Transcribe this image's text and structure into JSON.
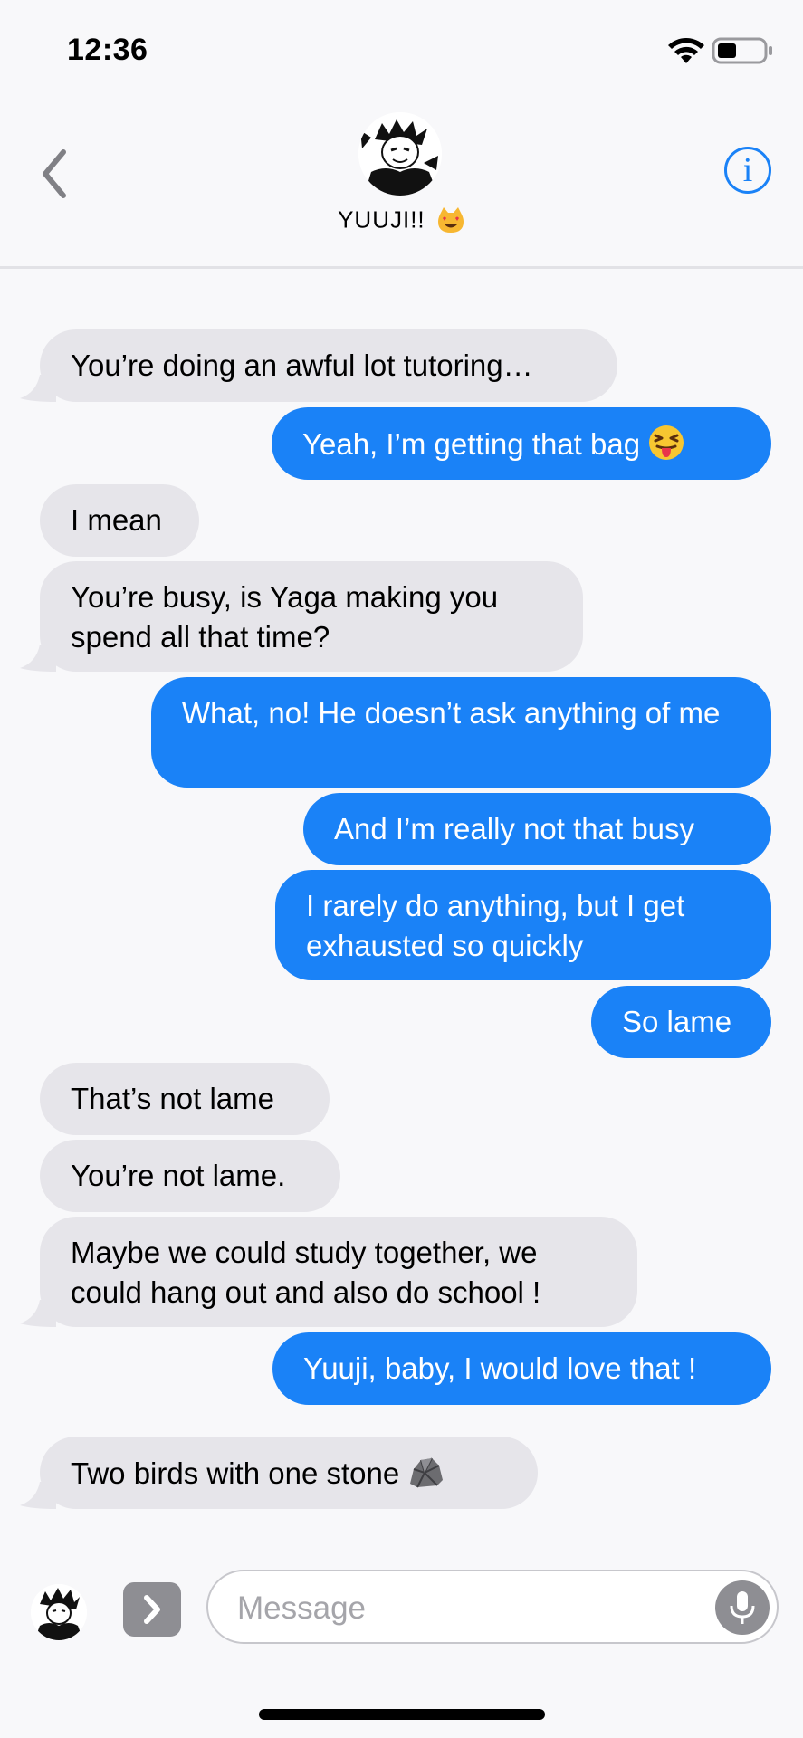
{
  "status_bar": {
    "time": "12:36"
  },
  "header": {
    "contact_name": "YUUJI!!",
    "name_emoji": "smiling-cat-heart-eyes",
    "info_label": "i"
  },
  "messages": [
    {
      "side": "in",
      "text": "You’re doing an awful lot tutoring…",
      "tail": true
    },
    {
      "side": "out",
      "text": "Yeah, I’m getting that bag",
      "emoji": "squinting-tongue-face"
    },
    {
      "side": "in",
      "text": "I mean",
      "tail": false
    },
    {
      "side": "in",
      "text": "You’re busy, is Yaga making you spend all that time?",
      "tail": true
    },
    {
      "side": "out",
      "text": "What, no! He doesn’t ask anything of me"
    },
    {
      "side": "out",
      "text": "And I’m really not that busy"
    },
    {
      "side": "out",
      "text": "I rarely do anything, but I get exhausted so quickly"
    },
    {
      "side": "out",
      "text": "So lame"
    },
    {
      "side": "in",
      "text": "That’s not lame",
      "tail": false
    },
    {
      "side": "in",
      "text": "You’re not lame.",
      "tail": false
    },
    {
      "side": "in",
      "text": "Maybe we could study together, we could hang out and also do school !",
      "tail": true
    },
    {
      "side": "out",
      "text": "Yuuji, baby, I would love that !"
    },
    {
      "side": "in",
      "text": "Two birds with one stone",
      "emoji": "rock",
      "tail": true
    }
  ],
  "input": {
    "placeholder": "Message"
  },
  "colors": {
    "outgoing": "#1a82f7",
    "incoming": "#e6e5ea",
    "background": "#f8f8fa"
  }
}
